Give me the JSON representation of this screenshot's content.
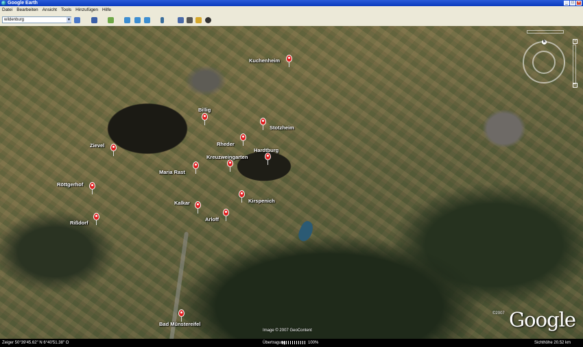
{
  "app": {
    "title": "Google Earth"
  },
  "menu": [
    "Datei",
    "Bearbeiten",
    "Ansicht",
    "Tools",
    "Hinzufügen",
    "Hilfe"
  ],
  "search": {
    "value": "wildenburg"
  },
  "map": {
    "places": [
      {
        "name": "Kuchenheim"
      },
      {
        "name": "Billig"
      },
      {
        "name": "Stotzheim"
      },
      {
        "name": "Zievel"
      },
      {
        "name": "Rheder"
      },
      {
        "name": "Hardtburg"
      },
      {
        "name": "Kreuzweingarten"
      },
      {
        "name": "Maria Rast"
      },
      {
        "name": "Röttgerhof"
      },
      {
        "name": "Kalkar"
      },
      {
        "name": "Kirspenich"
      },
      {
        "name": "Rißdorf"
      },
      {
        "name": "Arloff"
      },
      {
        "name": "Bad Münstereifel"
      }
    ],
    "image_credit": "Image © 2007 GeoContent",
    "copyright": "©2007",
    "logo": "Google",
    "nav_north": "N"
  },
  "status": {
    "pointer": "Zeiger  50°39'45.62\" N     6°40'51.38\" O",
    "streaming_label": "Übertragung",
    "streaming_percent": "100%",
    "eye_alt": "Sichthöhe   20.52 km"
  },
  "colors": {
    "placemark": "#e02020",
    "titlebar": "#0a3bbd"
  }
}
